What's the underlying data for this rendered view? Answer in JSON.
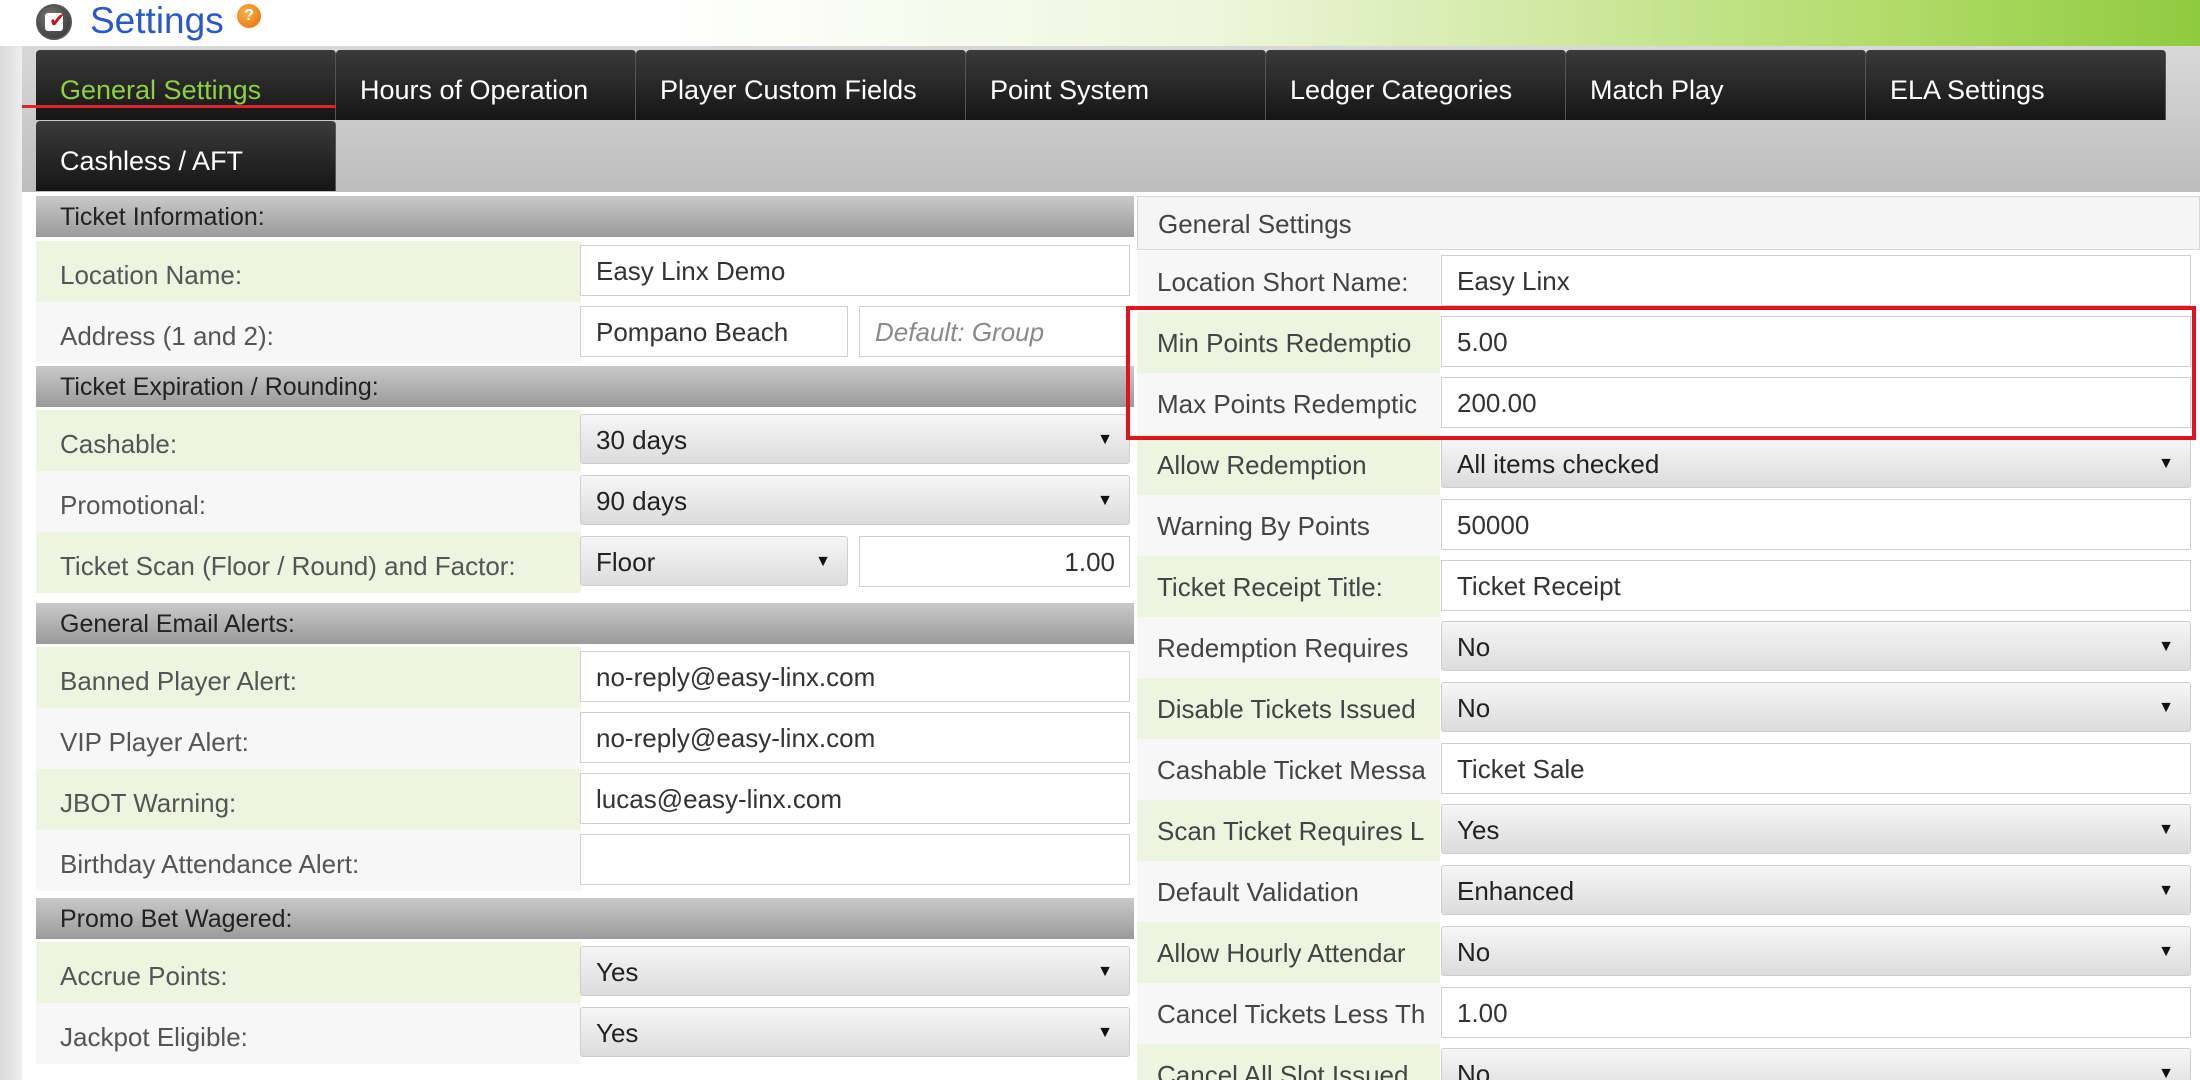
{
  "header": {
    "title": "Settings",
    "help_icon": "?"
  },
  "tabs": [
    {
      "label": "General Settings",
      "active": true
    },
    {
      "label": "Hours of Operation"
    },
    {
      "label": "Player Custom Fields"
    },
    {
      "label": "Point System"
    },
    {
      "label": "Ledger Categories"
    },
    {
      "label": "Match Play"
    },
    {
      "label": "ELA Settings"
    },
    {
      "label": "Cashless / AFT"
    }
  ],
  "left": {
    "ticket_information": {
      "heading": "Ticket Information:",
      "location_name": {
        "label": "Location Name:",
        "value": "Easy Linx Demo"
      },
      "address": {
        "label": "Address (1 and 2):",
        "value": "Pompano Beach",
        "placeholder": "Default: Group"
      }
    },
    "ticket_expiration": {
      "heading": "Ticket Expiration / Rounding:",
      "cashable": {
        "label": "Cashable:",
        "value": "30 days"
      },
      "promotional": {
        "label": "Promotional:",
        "value": "90 days"
      },
      "ticket_scan": {
        "label": "Ticket Scan (Floor / Round) and Factor:",
        "mode": "Floor",
        "factor": "1.00"
      }
    },
    "email_alerts": {
      "heading": "General Email Alerts:",
      "banned": {
        "label": "Banned Player Alert:",
        "value": "no-reply@easy-linx.com"
      },
      "vip": {
        "label": "VIP Player Alert:",
        "value": "no-reply@easy-linx.com"
      },
      "jbot": {
        "label": "JBOT Warning:",
        "value": "lucas@easy-linx.com"
      },
      "birthday": {
        "label": "Birthday Attendance Alert:",
        "value": ""
      }
    },
    "promo_bet": {
      "heading": "Promo Bet Wagered:",
      "accrue": {
        "label": "Accrue Points:",
        "value": "Yes"
      },
      "jackpot": {
        "label": "Jackpot Eligible:",
        "value": "Yes"
      }
    }
  },
  "right": {
    "heading": "General Settings",
    "rows": [
      {
        "label": "Location Short Name:",
        "value": "Easy Linx",
        "type": "input"
      },
      {
        "label": "Min Points Redemptio",
        "value": "5.00",
        "type": "input"
      },
      {
        "label": "Max Points Redemptic",
        "value": "200.00",
        "type": "input"
      },
      {
        "label": "Allow Redemption",
        "value": "All items checked",
        "type": "select"
      },
      {
        "label": "Warning By Points",
        "value": "50000",
        "type": "input"
      },
      {
        "label": "Ticket Receipt Title:",
        "value": "Ticket Receipt",
        "type": "input"
      },
      {
        "label": "Redemption Requires",
        "value": "No",
        "type": "select"
      },
      {
        "label": "Disable Tickets Issued",
        "value": "No",
        "type": "select"
      },
      {
        "label": "Cashable Ticket Messa",
        "value": "Ticket Sale",
        "type": "input"
      },
      {
        "label": "Scan Ticket Requires L",
        "value": "Yes",
        "type": "select"
      },
      {
        "label": "Default Validation",
        "value": "Enhanced",
        "type": "select"
      },
      {
        "label": "Allow Hourly Attendar",
        "value": "No",
        "type": "select"
      },
      {
        "label": "Cancel Tickets Less Th",
        "value": "1.00",
        "type": "input"
      },
      {
        "label": "Cancel All Slot Issued",
        "value": "No",
        "type": "select"
      }
    ]
  },
  "colors": {
    "accent": "#8fd03d",
    "title": "#2a58c8",
    "highlight": "#e0141e",
    "tab_bg": "#1f1f1f"
  }
}
